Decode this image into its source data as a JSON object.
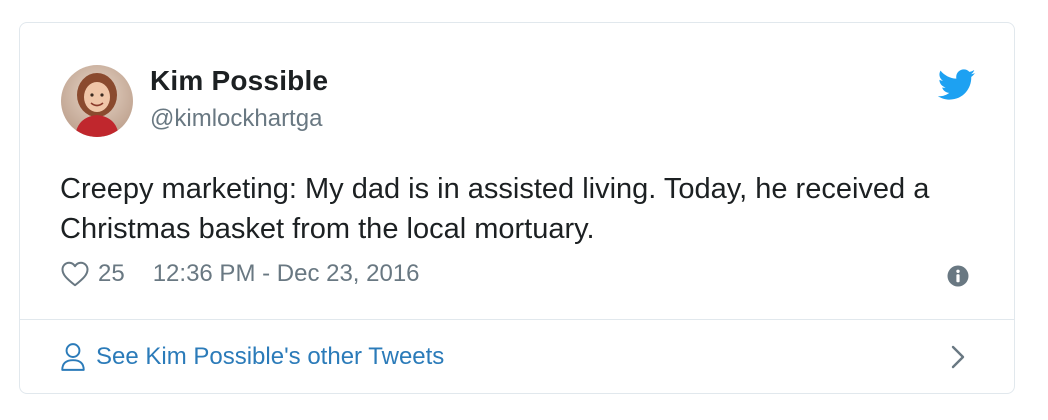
{
  "author": {
    "name": "Kim Possible",
    "handle": "@kimlockhartga"
  },
  "tweet": {
    "text": "Creepy marketing: My dad is in assisted living. Today, he received a Christmas basket from the local mortuary.",
    "likes": "25",
    "timestamp": "12:36 PM - Dec 23, 2016"
  },
  "footer": {
    "link_label": "See Kim Possible's other Tweets"
  },
  "icons": {
    "brand": "twitter-bird-icon",
    "like": "heart-icon",
    "info": "info-icon",
    "profile": "person-icon",
    "more": "chevron-right-icon"
  },
  "colors": {
    "twitter_blue": "#1da1f2",
    "link_blue": "#2b7bb9",
    "secondary_text": "#697882",
    "border": "#e1e8ed"
  }
}
